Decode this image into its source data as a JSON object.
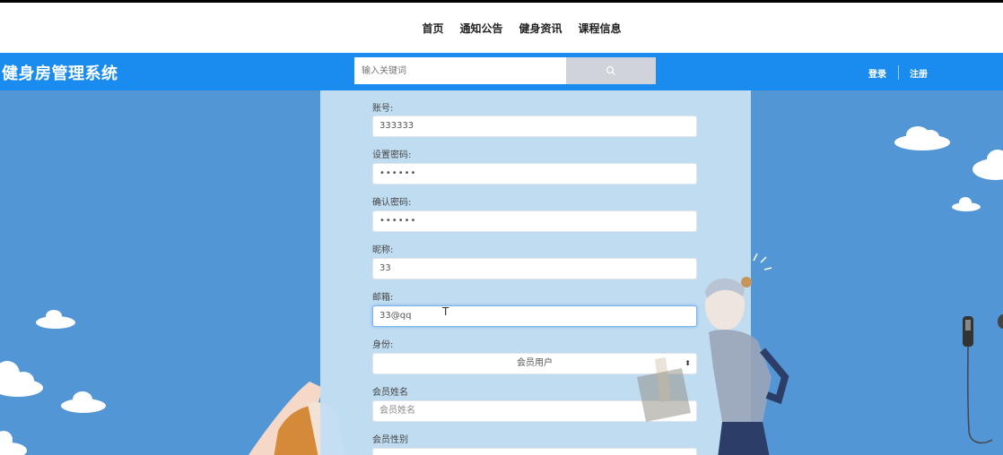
{
  "nav": {
    "items": [
      "首页",
      "通知公告",
      "健身资讯",
      "课程信息"
    ]
  },
  "header": {
    "brand": "健身房管理系统",
    "search_placeholder": "输入关键词",
    "login": "登录",
    "register": "注册"
  },
  "form": {
    "account_label": "账号:",
    "account_value": "333333",
    "password_label": "设置密码:",
    "password_value": "••••••",
    "confirm_label": "确认密码:",
    "confirm_value": "••••••",
    "nickname_label": "昵称:",
    "nickname_value": "33",
    "email_label": "邮箱:",
    "email_value": "33@qq",
    "identity_label": "身份:",
    "identity_value": "会员用户",
    "member_name_label": "会员姓名",
    "member_name_placeholder": "会员姓名",
    "member_gender_label": "会员性别"
  },
  "colors": {
    "header_bg": "#1a8cf0",
    "page_bg": "#5296d5",
    "panel_bg": "#c3def2"
  }
}
